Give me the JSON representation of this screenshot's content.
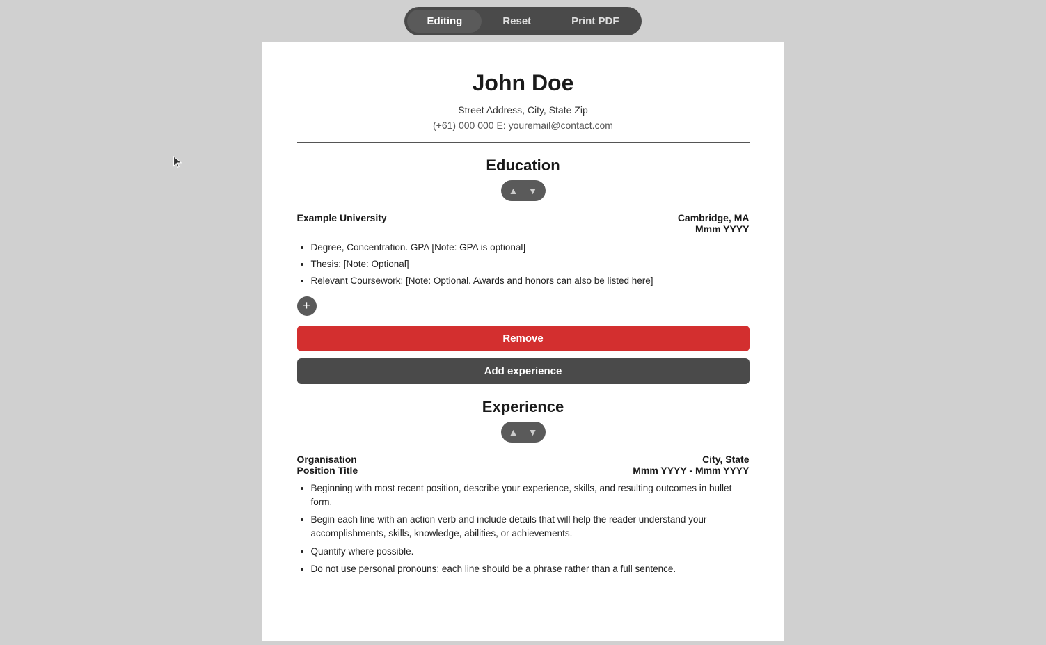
{
  "toolbar": {
    "editing_label": "Editing",
    "reset_label": "Reset",
    "print_label": "Print PDF"
  },
  "resume": {
    "name": "John Doe",
    "address": "Street Address, City, State Zip",
    "contact": "(+61) 000 000 E: youremail@contact.com",
    "sections": {
      "education": {
        "title": "Education",
        "entries": [
          {
            "institution": "Example University",
            "location": "Cambridge, MA",
            "dates": "Mmm YYYY",
            "bullets": [
              "Degree, Concentration. GPA [Note: GPA is optional]",
              "Thesis: [Note: Optional]",
              "Relevant Coursework: [Note: Optional. Awards and honors can also be listed here]"
            ]
          }
        ],
        "remove_label": "Remove",
        "add_label": "Add experience"
      },
      "experience": {
        "title": "Experience",
        "entries": [
          {
            "organization": "Organisation",
            "position": "Position Title",
            "location": "City, State",
            "dates": "Mmm YYYY  -  Mmm YYYY",
            "bullets": [
              "Beginning with most recent position, describe your experience, skills, and resulting outcomes in bullet form.",
              "Begin each line with an action verb and include details that will help the reader understand your accomplishments, skills, knowledge, abilities, or achievements.",
              "Quantify where possible.",
              "Do not use personal pronouns; each line should be a phrase rather than a full sentence."
            ]
          }
        ]
      }
    }
  }
}
